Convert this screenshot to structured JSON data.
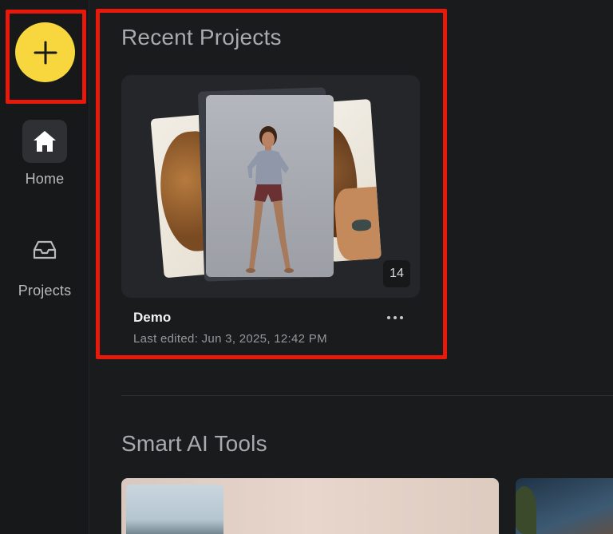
{
  "sidebar": {
    "add_button_icon": "plus-icon",
    "items": [
      {
        "label": "Home",
        "icon": "home-icon",
        "active": true
      },
      {
        "label": "Projects",
        "icon": "inbox-tray-icon",
        "active": false
      }
    ]
  },
  "recent_projects": {
    "title": "Recent Projects",
    "projects": [
      {
        "name": "Demo",
        "last_edited": "Last edited: Jun 3, 2025, 12:42 PM",
        "image_count": "14"
      }
    ]
  },
  "smart_tools": {
    "title": "Smart AI Tools"
  },
  "colors": {
    "background": "#1a1b1d",
    "fab": "#f7d63e",
    "highlight": "#e8190b"
  }
}
